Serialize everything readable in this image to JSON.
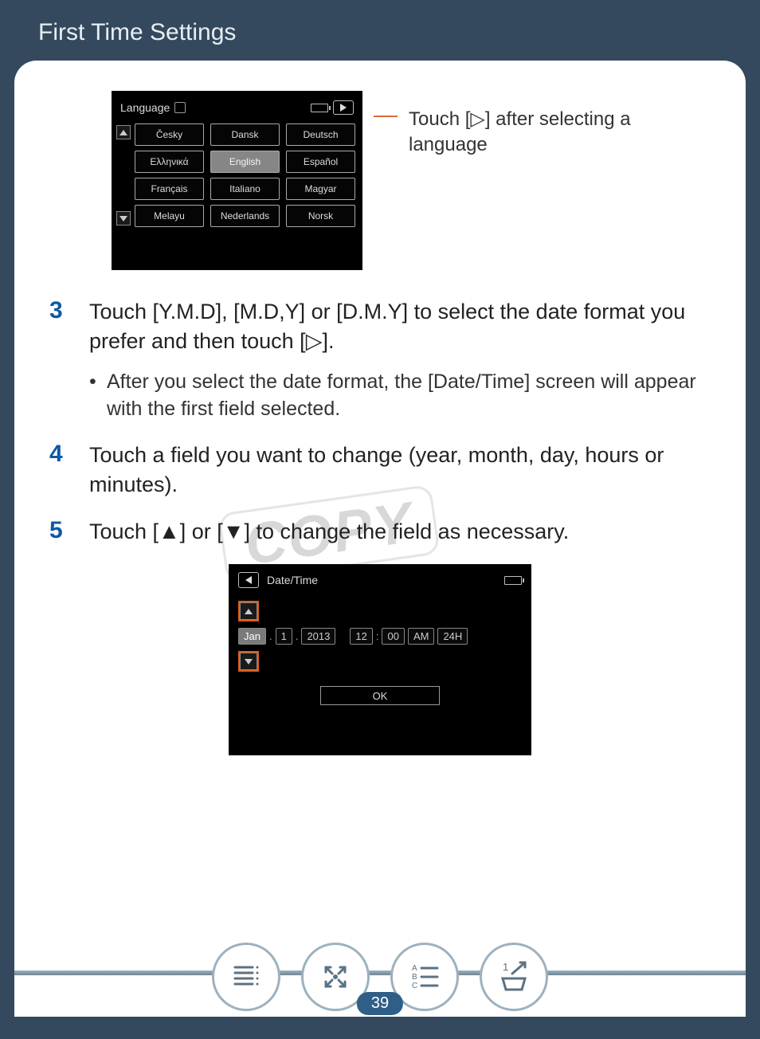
{
  "header": {
    "title": "First Time Settings"
  },
  "callout": "Touch [▷] after selecting a language",
  "langScreen": {
    "title": "Language",
    "options": [
      "Česky",
      "Dansk",
      "Deutsch",
      "Ελληνικά",
      "English",
      "Español",
      "Français",
      "Italiano",
      "Magyar",
      "Melayu",
      "Nederlands",
      "Norsk"
    ],
    "selectedIndex": 4
  },
  "steps": {
    "s3": {
      "num": "3",
      "text": "Touch [Y.M.D], [M.D,Y] or [D.M.Y] to select the date format you prefer and then touch [▷].",
      "bullet": "After you select the date format, the [Date/Time] screen will appear with the first field selected."
    },
    "s4": {
      "num": "4",
      "text": "Touch a field you want to change (year, month, day, hours or minutes)."
    },
    "s5": {
      "num": "5",
      "text": "Touch [▲] or [▼] to change the field as necessary."
    }
  },
  "dtScreen": {
    "title": "Date/Time",
    "month": "Jan",
    "day": "1",
    "year": "2013",
    "hour": "12",
    "minute": "00",
    "ampm": "AM",
    "mode": "24H",
    "ok": "OK"
  },
  "watermark": "COPY",
  "pageNumber": "39"
}
